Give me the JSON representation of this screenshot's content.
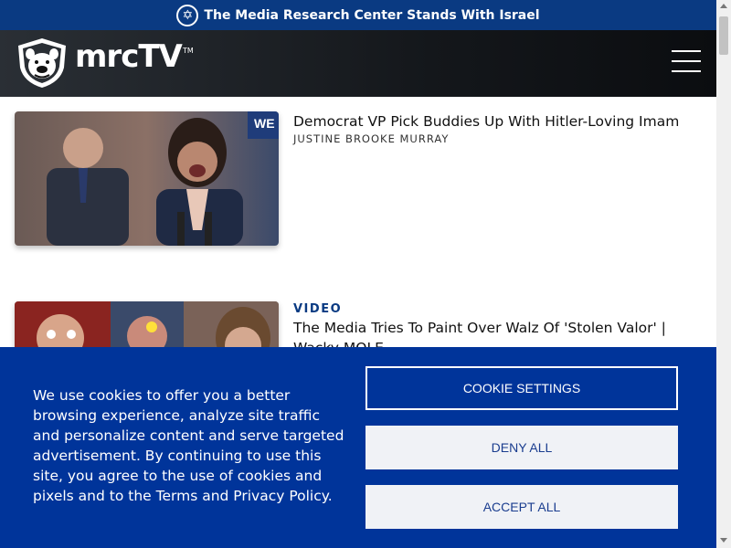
{
  "banner": {
    "text": "The Media Research Center Stands With Israel",
    "icon": "star-of-david-icon"
  },
  "header": {
    "logo_text": "mrcTV",
    "logo_tm": "TM",
    "menu_icon": "hamburger-menu-icon"
  },
  "articles": [
    {
      "category": "",
      "title": "Democrat VP Pick Buddies Up With Hitler-Loving Imam",
      "author": "JUSTINE BROOKE MURRAY"
    },
    {
      "category": "VIDEO",
      "title": "The Media Tries To Paint Over Walz Of 'Stolen Valor' | Wacky MOLE",
      "author": ""
    }
  ],
  "cookie": {
    "text": "We use cookies to offer you a better browsing experience, analyze site traffic and personalize content and serve targeted advertisement. By continuing to use this site, you agree to the use of cookies and pixels and to the Terms and Privacy Policy.",
    "settings_label": "COOKIE SETTINGS",
    "deny_label": "DENY ALL",
    "accept_label": "ACCEPT ALL"
  },
  "colors": {
    "brand_blue": "#0a3a82",
    "cookie_blue": "#00349a"
  }
}
